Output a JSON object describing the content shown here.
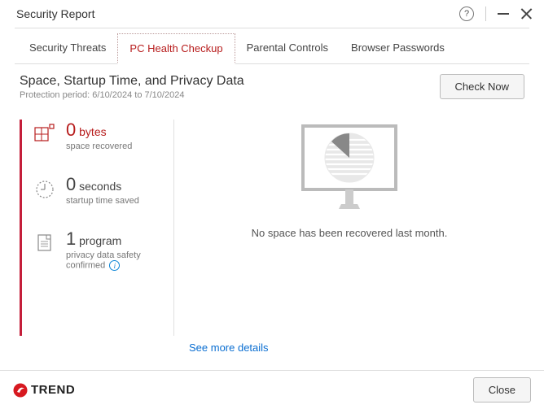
{
  "window": {
    "title": "Security Report"
  },
  "tabs": {
    "t0": "Security Threats",
    "t1": "PC Health Checkup",
    "t2": "Parental Controls",
    "t3": "Browser Passwords"
  },
  "header": {
    "title": "Space, Startup Time, and Privacy Data",
    "subtitle": "Protection period: 6/10/2024 to 7/10/2024",
    "check_now": "Check Now"
  },
  "stats": {
    "space": {
      "value": "0",
      "unit": "bytes",
      "label": "space recovered"
    },
    "startup": {
      "value": "0",
      "unit": "seconds",
      "label": "startup time saved"
    },
    "privacy": {
      "value": "1",
      "unit": "program",
      "label": "privacy data safety confirmed"
    }
  },
  "status_message": "No space has been recovered last month.",
  "see_more": "See more details",
  "footer": {
    "brand": "TREND",
    "close": "Close"
  }
}
